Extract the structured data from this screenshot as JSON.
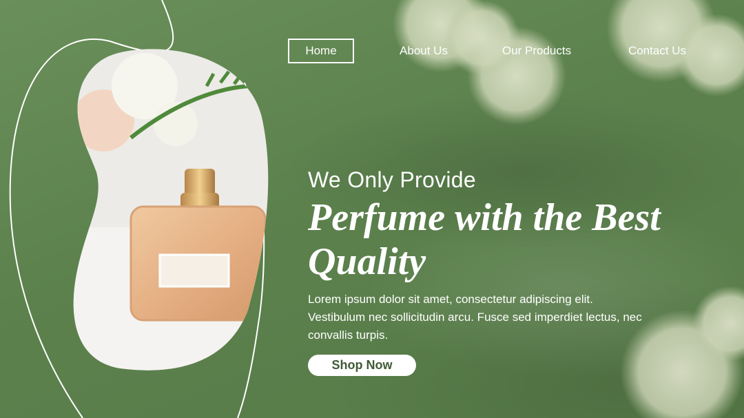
{
  "nav": {
    "items": [
      {
        "label": "Home"
      },
      {
        "label": "About Us"
      },
      {
        "label": "Our Products"
      },
      {
        "label": "Contact Us"
      }
    ]
  },
  "hero": {
    "eyebrow": "We Only Provide",
    "headline": "Perfume with the Best Quality",
    "body": "Lorem ipsum dolor sit amet, consectetur adipiscing elit. Vestibulum nec sollicitudin arcu. Fusce sed imperdiet lectus, nec convallis turpis.",
    "cta_label": "Shop Now"
  },
  "colors": {
    "background": "#5f8450",
    "text": "#ffffff",
    "button_text": "#3f5a35",
    "bottle": "#e7b48a"
  },
  "icons": [
    "flower-decoration",
    "perfume-bottle-image"
  ]
}
